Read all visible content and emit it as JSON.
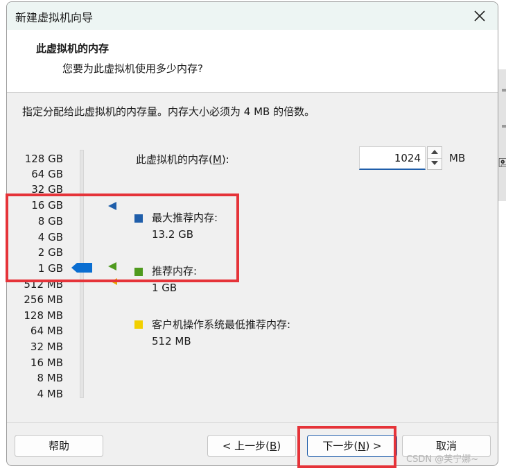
{
  "window": {
    "title": "新建虚拟机向导"
  },
  "header": {
    "title": "此虚拟机的内存",
    "subtitle": "您要为此虚拟机使用多少内存?"
  },
  "instruction": "指定分配给此虚拟机的内存量。内存大小必须为 4 MB 的倍数。",
  "scale": {
    "labels": [
      "128 GB",
      "64 GB",
      "32 GB",
      "16 GB",
      "8 GB",
      "4 GB",
      "2 GB",
      "1 GB",
      "512 MB",
      "256 MB",
      "128 MB",
      "64 MB",
      "32 MB",
      "16 MB",
      "8 MB",
      "4 MB"
    ],
    "selected": "1 GB"
  },
  "memory": {
    "label": "此虚拟机的内存(M):",
    "label_main": "此虚拟机的内存(",
    "label_key": "M",
    "label_end": "):",
    "value": "1024",
    "unit": "MB"
  },
  "legend": {
    "max": {
      "label": "最大推荐内存:",
      "value": "13.2 GB",
      "color": "#1f5eaa"
    },
    "recommended": {
      "label": "推荐内存:",
      "value": "1 GB",
      "color": "#4f9a1e"
    },
    "guest_min": {
      "label": "客户机操作系统最低推荐内存:",
      "value": "512 MB",
      "color": "#f2d000"
    }
  },
  "buttons": {
    "help": "帮助",
    "back_main": "< 上一步(",
    "back_key": "B",
    "back_end": ")",
    "next_main": "下一步(",
    "next_key": "N",
    "next_end": ") >",
    "cancel": "取消"
  },
  "icons": {
    "close": "close-icon",
    "spin_up": "chevron-up-icon",
    "spin_down": "chevron-down-icon"
  },
  "watermark": "CSDN @芙宁娜~",
  "highlight_color": "#e53339"
}
